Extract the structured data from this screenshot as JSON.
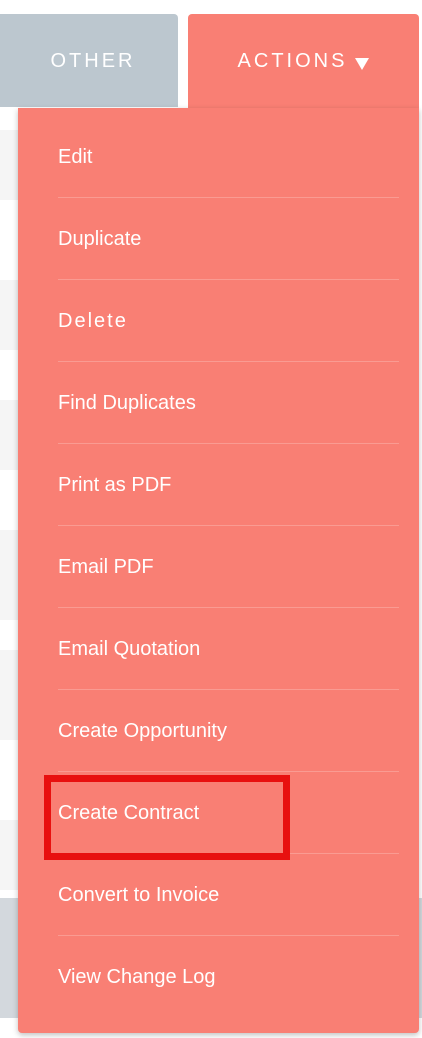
{
  "tabs": {
    "other_label": "OTHER",
    "actions_label": "ACTIONS"
  },
  "actions_menu": {
    "items": [
      "Edit",
      "Duplicate",
      "Delete",
      "Find Duplicates",
      "Print as PDF",
      "Email PDF",
      "Email Quotation",
      "Create Opportunity",
      "Create Contract",
      "Convert to Invoice",
      "View Change Log"
    ],
    "highlighted_item": "Create Contract"
  },
  "colors": {
    "actions_accent": "#f97f74",
    "other_tab": "#bcc7cf",
    "highlight_border": "#e8100f"
  },
  "icons": {
    "actions_dropdown": "caret-down-icon"
  }
}
